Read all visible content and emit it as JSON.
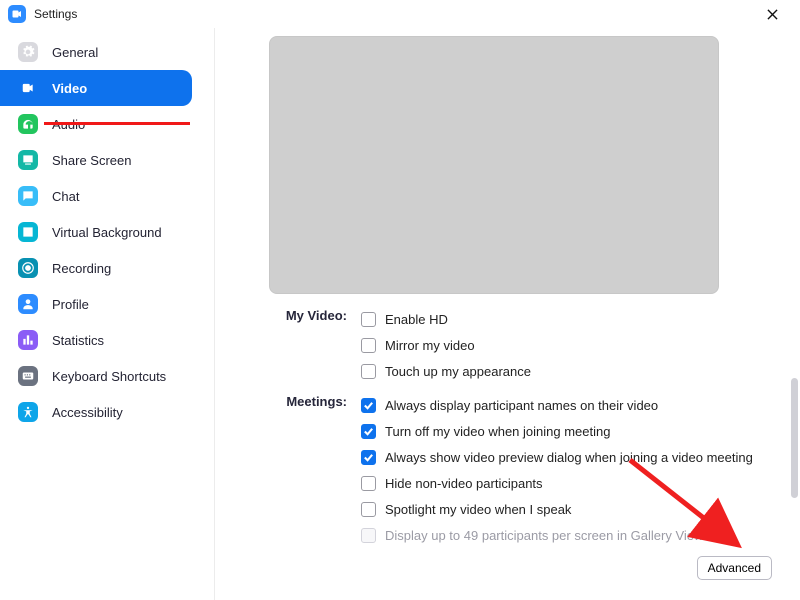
{
  "window": {
    "title": "Settings"
  },
  "sidebar": {
    "items": [
      {
        "label": "General"
      },
      {
        "label": "Video"
      },
      {
        "label": "Audio"
      },
      {
        "label": "Share Screen"
      },
      {
        "label": "Chat"
      },
      {
        "label": "Virtual Background"
      },
      {
        "label": "Recording"
      },
      {
        "label": "Profile"
      },
      {
        "label": "Statistics"
      },
      {
        "label": "Keyboard Shortcuts"
      },
      {
        "label": "Accessibility"
      }
    ]
  },
  "main": {
    "groups": {
      "myvideo": {
        "label": "My Video:",
        "opts": [
          {
            "label": "Enable HD"
          },
          {
            "label": "Mirror my video"
          },
          {
            "label": "Touch up my appearance"
          }
        ]
      },
      "meetings": {
        "label": "Meetings:",
        "opts": [
          {
            "label": "Always display participant names on their video"
          },
          {
            "label": "Turn off my video when joining meeting"
          },
          {
            "label": "Always show video preview dialog when joining a video meeting"
          },
          {
            "label": "Hide non-video participants"
          },
          {
            "label": "Spotlight my video when I speak"
          },
          {
            "label": "Display up to 49 participants per screen in Gallery View"
          }
        ]
      }
    },
    "advanced": "Advanced"
  }
}
